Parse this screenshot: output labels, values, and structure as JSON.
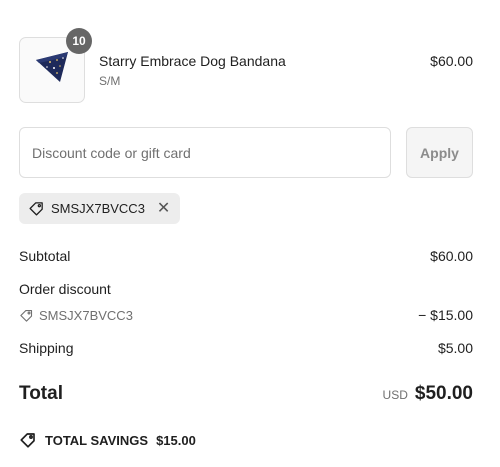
{
  "product": {
    "name": "Starry Embrace Dog Bandana",
    "variant": "S/M",
    "price": "$60.00",
    "quantity": "10",
    "image_icon": "navy-starry-bandana-image"
  },
  "discount": {
    "placeholder": "Discount code or gift card",
    "apply_label": "Apply",
    "applied_code": "SMSJX7BVCC3",
    "tag_icon": "tag-icon",
    "remove_icon": "close-icon"
  },
  "summary": {
    "subtotal_label": "Subtotal",
    "subtotal_value": "$60.00",
    "order_discount_label": "Order discount",
    "discount_code": "SMSJX7BVCC3",
    "discount_value": "− $15.00",
    "shipping_label": "Shipping",
    "shipping_value": "$5.00",
    "total_label": "Total",
    "currency": "USD",
    "total_value": "$50.00",
    "savings_label": "TOTAL SAVINGS",
    "savings_value": "$15.00"
  },
  "colors": {
    "text": "#1f1f1f",
    "muted": "#707070",
    "badge": "#666666",
    "chip_bg": "#ededed",
    "bandana": "#1e2a5a"
  }
}
